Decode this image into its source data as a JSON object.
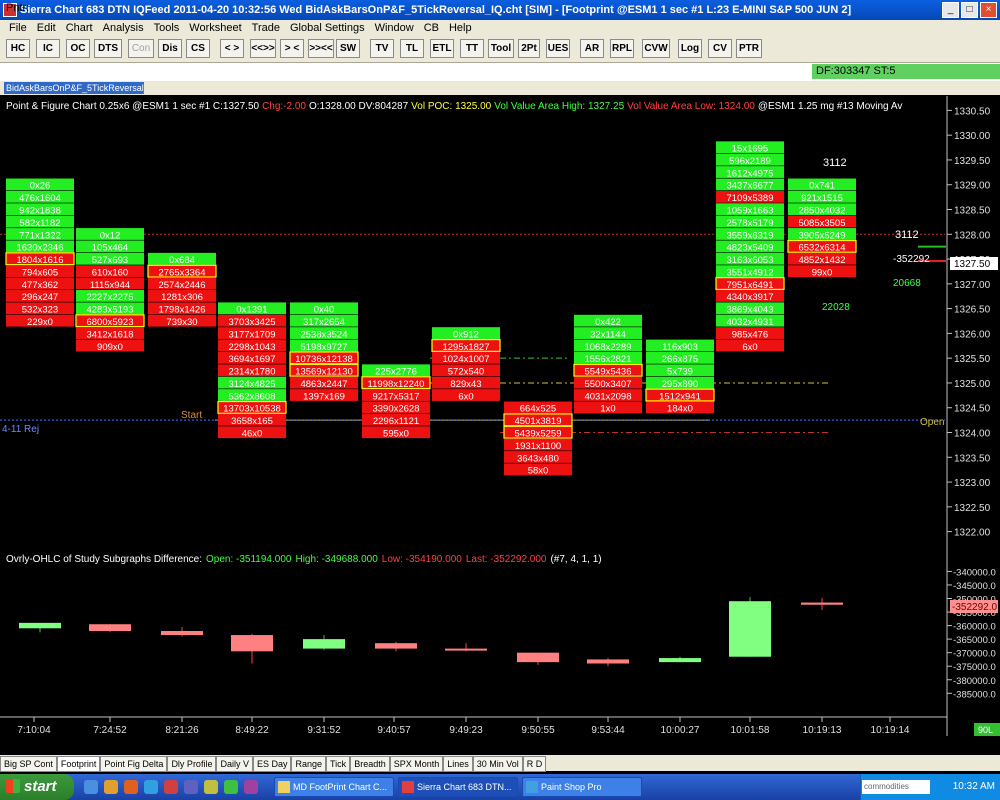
{
  "window": {
    "title": "Sierra Chart 683 DTN IQFeed 2011-04-20  10:32:56  Wed   BidAskBarsOnP&F_5TickReversal_IQ.cht [SIM] - [Footprint  @ESM1  1 sec   #1  L:23  E-MINI S&P 500 JUN 2]"
  },
  "menu": [
    "File",
    "Edit",
    "Chart",
    "Analysis",
    "Tools",
    "Worksheet",
    "Trade",
    "Global Settings",
    "Window",
    "CB",
    "Help"
  ],
  "toolbar": [
    "HC",
    "IC",
    "OC",
    "DTS",
    "Con",
    "Dis",
    "CS",
    "< >",
    "<<>>",
    "> <",
    ">><<",
    "SW",
    "TV",
    "TL",
    "ETL",
    "TT",
    "Tool",
    "2Pt",
    "UES",
    "AR",
    "RPL",
    "CVW",
    "Log",
    "CV",
    "PTR"
  ],
  "pntr": {
    "label": "Pntr:",
    "df": "DF:303347   ST:5"
  },
  "doc_tab": "BidAskBarsOnP&F_5TickReversal_IQ",
  "header": {
    "p1": "Point & Figure Chart 0.25x6 @ESM1  1 sec   #1  C:1327.50",
    "p2": "Chg:-2.00",
    "p3": "O:1328.00  DV:804287",
    "p4": "Vol POC: 1325.00",
    "p5": "Vol Value Area High: 1327.25",
    "p6": "Vol Value Area Low: 1324.00",
    "p7": "@ESM1  1.25 mg  #13 Moving Av"
  },
  "study_header": {
    "p1": "Ovrly-OHLC of Study Subgraphs Difference:",
    "p2": "Open: -351194.000",
    "p3": "High: -349688.000",
    "p4": "Low: -354190.000",
    "p5": "Last: -352292.000",
    "p6": "(#7, 4, 1, 1)"
  },
  "labels": {
    "start": "Start",
    "rej": "4-11 Rej",
    "open": "Open",
    "price_badge": "1327.50",
    "study_badge": "-352292.0",
    "right_3112_a": "3112",
    "right_3112_b": "3112",
    "neg": "-352292",
    "g1": "20668",
    "g2": "22028",
    "corner": "90L"
  },
  "price_axis": {
    "labels": [
      "1330.50",
      "1330.00",
      "1329.50",
      "1329.00",
      "1328.50",
      "1328.00",
      "1327.50",
      "1327.00",
      "1326.50",
      "1326.00",
      "1325.50",
      "1325.00",
      "1324.50",
      "1324.00",
      "1323.50",
      "1323.00",
      "1322.50",
      "1322.00"
    ]
  },
  "study_axis": {
    "labels": [
      "-340000.0",
      "-345000.0",
      "-350000.0",
      "-355000.0",
      "-360000.0",
      "-365000.0",
      "-370000.0",
      "-375000.0",
      "-380000.0",
      "-385000.0"
    ]
  },
  "time_axis": {
    "labels": [
      "7:10:04",
      "7:24:52",
      "8:21:26",
      "8:49:22",
      "9:31:52",
      "9:40:57",
      "9:49:23",
      "9:50:55",
      "9:53:44",
      "10:00:27",
      "10:01:58",
      "10:19:13",
      "10:19:14"
    ]
  },
  "colors": {
    "up_green": "#22ee22",
    "down_red": "#ee1111",
    "text_green": "#55ee55",
    "text_red": "#ff5555"
  },
  "chart_data": {
    "type": "table",
    "columns": [
      {
        "time": "7:10:04",
        "top": 1329.0,
        "cells": [
          "0x26",
          "476x1604",
          "942x1838",
          "582x1182",
          "771x1322",
          "1630x2346",
          "1804x1616",
          "794x605",
          "477x362",
          "296x247",
          "532x323",
          "229x0"
        ]
      },
      {
        "time": "7:24:52",
        "top": 1328.0,
        "cells": [
          "0x12",
          "105x464",
          "527x693",
          "610x160",
          "1115x944",
          "2227x2275",
          "4283x5193",
          "6800x5923",
          "3412x1618",
          "909x0"
        ]
      },
      {
        "time": "8:21:26",
        "top": 1327.5,
        "cells": [
          "0x684",
          "2765x3364",
          "2574x2446",
          "1281x306",
          "1798x1426",
          "739x30"
        ]
      },
      {
        "time": "8:49:22",
        "top": 1326.5,
        "cells": [
          "0x1391",
          "3703x3425",
          "3177x1709",
          "2298x1043",
          "3694x1697",
          "2314x1780",
          "3124x4825",
          "5362x8608",
          "13703x10538",
          "3658x165",
          "46x0"
        ]
      },
      {
        "time": "9:31:52",
        "top": 1326.5,
        "cells": [
          "0x40",
          "317x2654",
          "2538x3524",
          "5198x9727",
          "10736x12138",
          "13569x12130",
          "4863x2447",
          "1397x169"
        ]
      },
      {
        "time": "9:40:57",
        "top": 1325.25,
        "cells": [
          "225x2776",
          "11998x12240",
          "9217x5317",
          "3390x2628",
          "2296x1121",
          "595x0"
        ]
      },
      {
        "time": "9:49:23",
        "top": 1326.0,
        "cells": [
          "0x912",
          "1295x1827",
          "1024x1007",
          "572x540",
          "829x43",
          "6x0"
        ]
      },
      {
        "time": "9:50:55",
        "top": 1324.5,
        "cells": [
          "664x525",
          "4501x3819",
          "5439x5259",
          "1931x1100",
          "3643x480",
          "58x0"
        ]
      },
      {
        "time": "9:53:44",
        "top": 1326.25,
        "cells": [
          "0x422",
          "32x1144",
          "1068x2289",
          "1556x2821",
          "5549x5436",
          "5500x3407",
          "4031x2098",
          "1x0"
        ]
      },
      {
        "time": "10:00:27",
        "top": 1325.75,
        "cells": [
          "116x903",
          "266x875",
          "5x739",
          "295x890",
          "1512x941",
          "184x0"
        ]
      },
      {
        "time": "10:01:58",
        "top": 1329.75,
        "cells": [
          "15x1695",
          "596x2189",
          "1612x4975",
          "3437x6677",
          "7109x5389",
          "1059x1663",
          "2578x5179",
          "3559x6319",
          "4823x5409",
          "3163x6053",
          "3551x4912",
          "7951x6491",
          "4340x3917",
          "3869x4043",
          "4032x4931",
          "985x476",
          "6x0"
        ]
      },
      {
        "time": "10:19:13",
        "top": 1329.0,
        "cells": [
          "0x741",
          "921x1515",
          "2850x4032",
          "5085x3505",
          "3905x5249",
          "6532x6314",
          "4852x1432",
          "99x0"
        ]
      }
    ],
    "column_colors": [
      [
        "g",
        "g",
        "g",
        "g",
        "g",
        "g",
        "y",
        "r",
        "r",
        "r",
        "r",
        "r"
      ],
      [
        "g",
        "g",
        "g",
        "r",
        "r",
        "g",
        "g",
        "y",
        "r",
        "r"
      ],
      [
        "g",
        "y",
        "r",
        "r",
        "r",
        "r"
      ],
      [
        "g",
        "r",
        "r",
        "r",
        "r",
        "r",
        "g",
        "g",
        "y",
        "r",
        "r"
      ],
      [
        "g",
        "g",
        "g",
        "g",
        "y",
        "y",
        "r",
        "r"
      ],
      [
        "g",
        "y",
        "r",
        "r",
        "r",
        "r"
      ],
      [
        "g",
        "y",
        "r",
        "r",
        "r",
        "r"
      ],
      [
        "r",
        "y",
        "y",
        "r",
        "r",
        "r"
      ],
      [
        "g",
        "g",
        "g",
        "g",
        "y",
        "r",
        "r",
        "r"
      ],
      [
        "g",
        "g",
        "g",
        "g",
        "y",
        "r"
      ],
      [
        "g",
        "g",
        "g",
        "g",
        "r",
        "g",
        "g",
        "g",
        "g",
        "g",
        "g",
        "y",
        "r",
        "g",
        "g",
        "r",
        "r"
      ],
      [
        "g",
        "g",
        "g",
        "r",
        "g",
        "y",
        "r",
        "r"
      ]
    ],
    "study_candles": [
      {
        "o": -361000,
        "h": -359000,
        "l": -362500,
        "c": -359000
      },
      {
        "o": -359500,
        "h": -359500,
        "l": -362500,
        "c": -362000
      },
      {
        "o": -362000,
        "h": -360500,
        "l": -364000,
        "c": -363500
      },
      {
        "o": -363500,
        "h": -363000,
        "l": -374000,
        "c": -369500
      },
      {
        "o": -368500,
        "h": -363500,
        "l": -369000,
        "c": -365000
      },
      {
        "o": -366500,
        "h": -366000,
        "l": -369500,
        "c": -368500
      },
      {
        "o": -368500,
        "h": -366500,
        "l": -369500,
        "c": -368500
      },
      {
        "o": -370000,
        "h": -370000,
        "l": -374500,
        "c": -373500
      },
      {
        "o": -372500,
        "h": -372000,
        "l": -375000,
        "c": -374000
      },
      {
        "o": -373500,
        "h": -371500,
        "l": -373500,
        "c": -372000
      },
      {
        "o": -371500,
        "h": -349500,
        "l": -371500,
        "c": -351000
      },
      {
        "o": -351500,
        "h": -349700,
        "l": -354200,
        "c": -352300
      }
    ],
    "price_range": [
      1321.75,
      1330.75
    ],
    "study_range": [
      -386000,
      -338000
    ],
    "ref_lines": [
      {
        "price": 1328.0,
        "style": "dotted-red"
      },
      {
        "price": 1325.5,
        "style": "dashdot-green"
      },
      {
        "price": 1325.0,
        "style": "dashdot-yellow"
      },
      {
        "price": 1324.25,
        "style": "solid-yellow"
      },
      {
        "price": 1324.0,
        "style": "dashdot-red"
      }
    ]
  },
  "bottom_tabs": [
    "Big SP Cont",
    "Footprint",
    "Point Fig Delta",
    "Dly Profile",
    "Daily V",
    "ES Day",
    "Range",
    "Tick",
    "Breadth",
    "SPX Month",
    "Lines",
    "30 Min Vol",
    "R D"
  ],
  "taskbar": {
    "start": "start",
    "tasks": [
      "MD FootPrint Chart C...",
      "Sierra Chart 683 DTN...",
      "Paint Shop Pro"
    ],
    "search": "commodities",
    "clock": "10:32 AM"
  }
}
